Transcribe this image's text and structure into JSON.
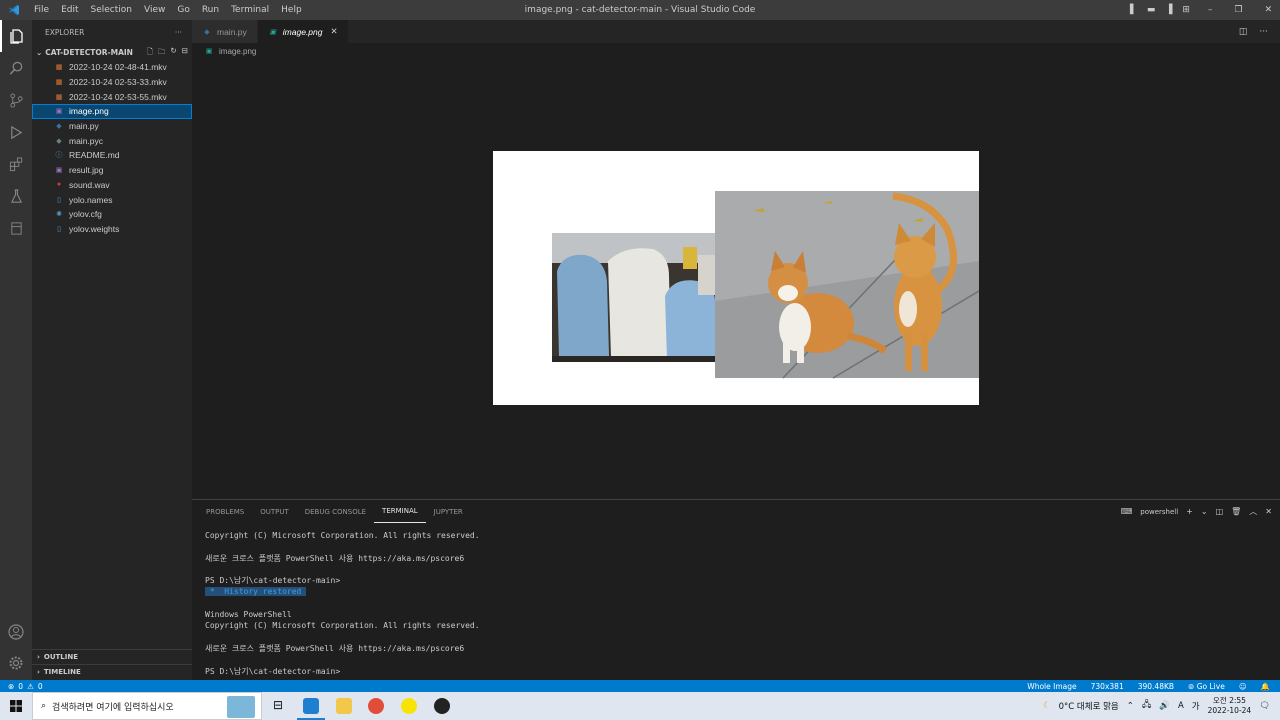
{
  "window": {
    "title": "image.png - cat-detector-main - Visual Studio Code"
  },
  "menu": [
    "File",
    "Edit",
    "Selection",
    "View",
    "Go",
    "Run",
    "Terminal",
    "Help"
  ],
  "explorer": {
    "header": "EXPLORER",
    "folder": "CAT-DETECTOR-MAIN",
    "files": [
      {
        "name": "2022-10-24 02-48-41.mkv",
        "icon": "video-icon",
        "color": "#e37933"
      },
      {
        "name": "2022-10-24 02-53-33.mkv",
        "icon": "video-icon",
        "color": "#e37933"
      },
      {
        "name": "2022-10-24 02-53-55.mkv",
        "icon": "video-icon",
        "color": "#e37933"
      },
      {
        "name": "image.png",
        "icon": "image-icon",
        "color": "#a074c4",
        "selected": true
      },
      {
        "name": "main.py",
        "icon": "python-icon",
        "color": "#3572a5"
      },
      {
        "name": "main.pyc",
        "icon": "python-icon",
        "color": "#6d8086"
      },
      {
        "name": "README.md",
        "icon": "info-icon",
        "color": "#519aba"
      },
      {
        "name": "result.jpg",
        "icon": "image-icon",
        "color": "#a074c4"
      },
      {
        "name": "sound.wav",
        "icon": "audio-icon",
        "color": "#cc3e44"
      },
      {
        "name": "yolo.names",
        "icon": "file-icon",
        "color": "#519aba"
      },
      {
        "name": "yolov.cfg",
        "icon": "gear-icon",
        "color": "#519aba"
      },
      {
        "name": "yolov.weights",
        "icon": "file-icon",
        "color": "#519aba"
      }
    ],
    "outline": "OUTLINE",
    "timeline": "TIMELINE"
  },
  "tabs": [
    {
      "label": "main.py",
      "active": false
    },
    {
      "label": "image.png",
      "active": true
    }
  ],
  "breadcrumb": "image.png",
  "panel": {
    "tabs": [
      "PROBLEMS",
      "OUTPUT",
      "DEBUG CONSOLE",
      "TERMINAL",
      "JUPYTER"
    ],
    "active_tab": "TERMINAL",
    "shell": "powershell",
    "lines": [
      "Copyright (C) Microsoft Corporation. All rights reserved.",
      "",
      "새로운 크로스 플랫폼 PowerShell 사용 https://aka.ms/pscore6",
      "",
      "PS D:\\남기\\cat-detector-main>",
      "",
      "",
      "Windows PowerShell",
      "Copyright (C) Microsoft Corporation. All rights reserved.",
      "",
      "새로운 크로스 플랫폼 PowerShell 사용 https://aka.ms/pscore6",
      "",
      "PS D:\\남기\\cat-detector-main>"
    ],
    "history": " *  History restored "
  },
  "status": {
    "errors": "0",
    "warnings": "0",
    "zoom": "Whole Image",
    "dimensions": "730x381",
    "size": "390.48KB",
    "golive": "Go Live"
  },
  "taskbar": {
    "search_placeholder": "검색하려면 여기에 입력하십시오",
    "weather": "0°C  대체로 맑음",
    "lang": "A",
    "ime": "가",
    "time": "오전 2:55",
    "date": "2022-10-24"
  },
  "colors": {
    "accent": "#007acc",
    "selection": "#094771"
  }
}
